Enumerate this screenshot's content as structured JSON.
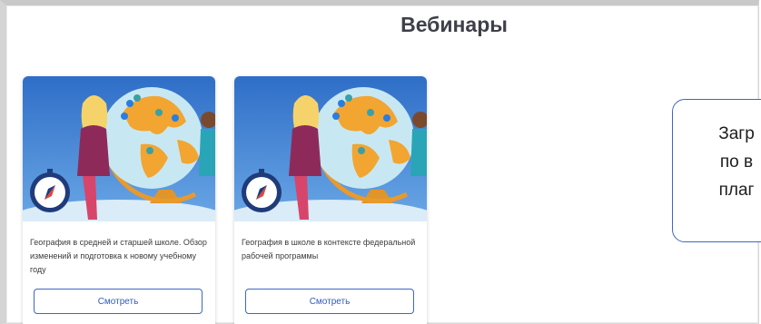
{
  "page": {
    "title": "Вебинары"
  },
  "cards": [
    {
      "description": "География в средней и старшей школе. Обзор изменений и подготовка к новому учебному году",
      "button_label": "Смотреть"
    },
    {
      "description": "География в школе в контексте федеральной рабочей программы",
      "button_label": "Смотреть"
    }
  ],
  "callout": {
    "lines": [
      "Загр",
      "по в",
      "плаг"
    ]
  },
  "colors": {
    "accent": "#3b67c7",
    "card_sky": "#4a8ddc",
    "globe_ocean": "#bfe3ef",
    "globe_land": "#f0a22e"
  }
}
